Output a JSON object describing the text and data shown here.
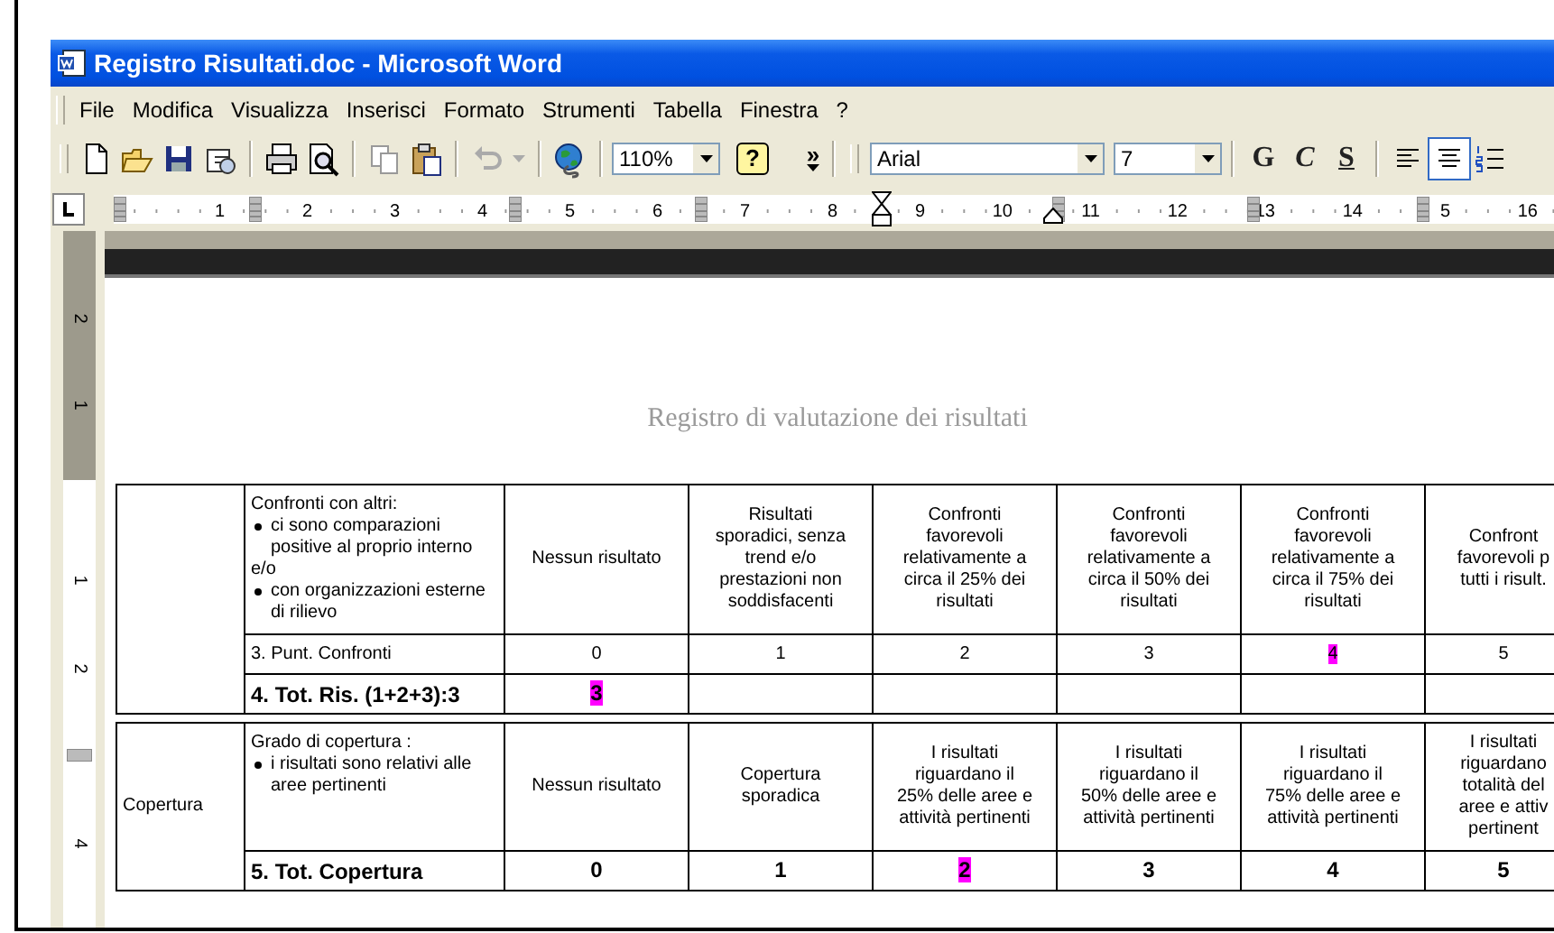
{
  "window": {
    "title": "Registro Risultati.doc - Microsoft Word"
  },
  "menu": [
    "File",
    "Modifica",
    "Visualizza",
    "Inserisci",
    "Formato",
    "Strumenti",
    "Tabella",
    "Finestra",
    "?"
  ],
  "toolbar": {
    "zoom": "110%",
    "help": "?",
    "overflow": "»",
    "font": "Arial",
    "size": "7",
    "format_buttons": [
      {
        "label": "G",
        "kind": "bold"
      },
      {
        "label": "C",
        "kind": "italic"
      },
      {
        "label": "S",
        "kind": "underline"
      }
    ],
    "align": [
      {
        "kind": "left",
        "selected": false
      },
      {
        "kind": "center",
        "selected": true
      }
    ]
  },
  "ruler": {
    "numbers": [
      "1",
      "2",
      "3",
      "4",
      "5",
      "6",
      "7",
      "8",
      "9",
      "10",
      "11",
      "12",
      "13",
      "14",
      "5",
      "16"
    ]
  },
  "vertical_ruler": [
    {
      "kind": "number",
      "text": "2"
    },
    {
      "kind": "number",
      "text": "1"
    },
    {
      "kind": "origin"
    },
    {
      "kind": "number",
      "text": "1"
    },
    {
      "kind": "number",
      "text": "2"
    },
    {
      "kind": "marker"
    },
    {
      "kind": "number",
      "text": "4"
    }
  ],
  "document": {
    "title": "Registro di valutazione dei risultati",
    "tables": [
      {
        "criteria": {
          "heading": "Confronti con altri:",
          "lines": [
            {
              "kind": "bullet",
              "text": "ci sono comparazioni positive al proprio interno"
            },
            {
              "kind": "plain",
              "text": "e/o"
            },
            {
              "kind": "bullet",
              "text": "con organizzazioni esterne di rilievo"
            }
          ]
        },
        "levels": [
          "Nessun risultato",
          "Risultati\nsporadici, senza\ntrend e/o\nprestazioni non\nsoddisfacenti",
          "Confronti\nfavorevoli\nrelativamente a\ncirca il 25% dei\nrisultati",
          "Confronti\nfavorevoli\nrelativamente a\ncirca il 50% dei\nrisultati",
          "Confronti\nfavorevoli\nrelativamente a\ncirca il 75% dei\nrisultati",
          "Confront\nfavorevoli p\ntutti i risult."
        ],
        "rows": [
          {
            "kind": "score",
            "label": "3. Punt. Confronti",
            "values": [
              {
                "text": "0",
                "selected": false
              },
              {
                "text": "1",
                "selected": false
              },
              {
                "text": "2",
                "selected": false
              },
              {
                "text": "3",
                "selected": false
              },
              {
                "text": "4",
                "selected": true
              },
              {
                "text": "5",
                "selected": false
              }
            ]
          },
          {
            "kind": "total",
            "label": "4. Tot. Ris. (1+2+3):3",
            "values": [
              {
                "text": "3",
                "selected": true
              }
            ]
          }
        ]
      },
      {
        "area": "Copertura",
        "criteria": {
          "heading": "Grado di copertura :",
          "lines": [
            {
              "kind": "bullet",
              "text": "i risultati sono relativi alle aree pertinenti"
            }
          ]
        },
        "levels": [
          "Nessun risultato",
          "Copertura\nsporadica",
          "I risultati\nriguardano il\n25% delle aree e\nattività pertinenti",
          "I risultati\nriguardano il\n50% delle aree e\nattività pertinenti",
          "I risultati\nriguardano il\n75% delle aree e\nattività pertinenti",
          "I risultati\nriguardano\ntotalità del\naree e attiv\npertinent"
        ],
        "rows": [
          {
            "kind": "total",
            "label": "5. Tot. Copertura",
            "values": [
              {
                "text": "0",
                "selected": false
              },
              {
                "text": "1",
                "selected": false
              },
              {
                "text": "2",
                "selected": true
              },
              {
                "text": "3",
                "selected": false
              },
              {
                "text": "4",
                "selected": false
              },
              {
                "text": "5",
                "selected": false
              }
            ]
          }
        ]
      }
    ]
  }
}
